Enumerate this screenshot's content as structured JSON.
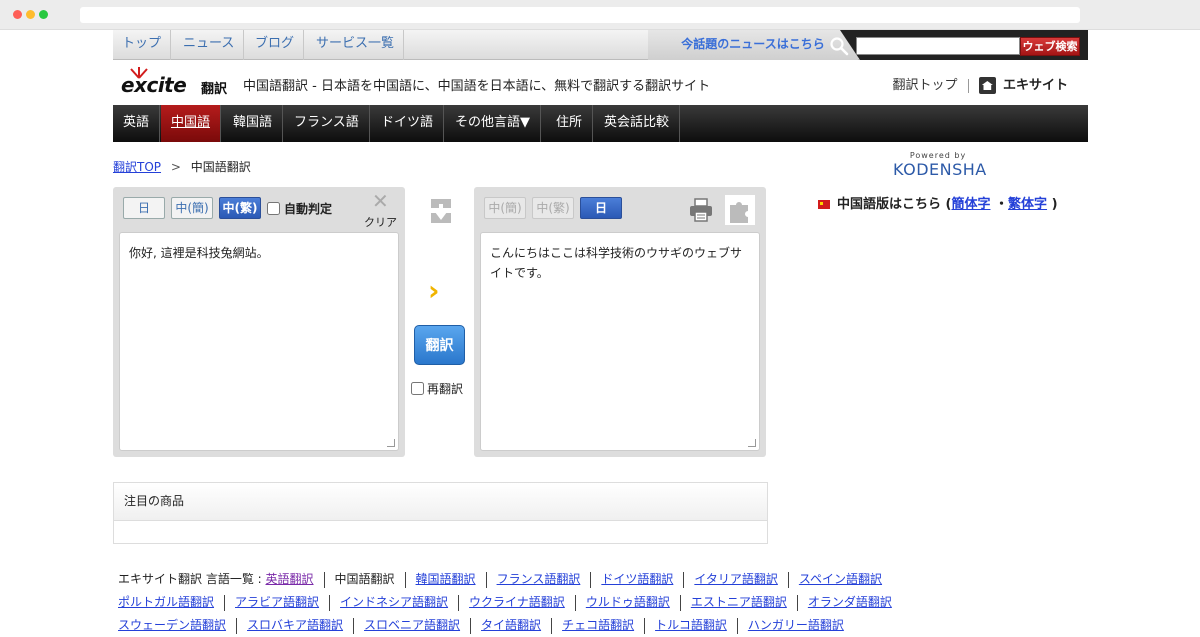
{
  "topnav": {
    "items": [
      "トップ",
      "ニュース",
      "ブログ",
      "サービス一覧"
    ],
    "hot_news": "今話題のニュースはこちら",
    "search_placeholder": "",
    "search_button": "ウェブ検索"
  },
  "header": {
    "logo_text": "excite",
    "logo_sub": "翻訳",
    "tagline": "中国語翻訳 - 日本語を中国語に、中国語を日本語に、無料で翻訳する翻訳サイト",
    "top_link": "翻訳トップ",
    "site_link": "エキサイト"
  },
  "langnav": {
    "items": [
      "英語",
      "中国語",
      "韓国語",
      "フランス語",
      "ドイツ語",
      "その他言語▼",
      "住所",
      "英会話比較"
    ],
    "active": "中国語"
  },
  "breadcrumb": {
    "home": "翻訳TOP",
    "sep": ">",
    "current": "中国語翻訳"
  },
  "powered": {
    "by": "Powered by",
    "brand": "KODENSHA"
  },
  "cn_version": {
    "label": "中国語版はこちら (",
    "simplified": "簡体字",
    "dot": "・",
    "traditional": "繁体字",
    "close": ")"
  },
  "source": {
    "lang_ja": "日",
    "lang_zh_simplified": "中(簡)",
    "lang_zh_traditional": "中(繁)",
    "auto_detect": "自動判定",
    "clear": "クリア",
    "text": "你好, 這裡是科技兔網站。"
  },
  "target": {
    "lang_zh_simplified": "中(簡)",
    "lang_zh_traditional": "中(繁)",
    "lang_ja": "日",
    "text": "こんにちはここは科学技術のウサギのウェブサイトです。"
  },
  "controls": {
    "translate": "翻訳",
    "retranslate": "再翻訳"
  },
  "featured": {
    "title": "注目の商品"
  },
  "langlist": {
    "prefix": "エキサイト翻訳 言語一覧 :",
    "row1": [
      "英語翻訳",
      "中国語翻訳",
      "韓国語翻訳",
      "フランス語翻訳",
      "ドイツ語翻訳",
      "イタリア語翻訳",
      "スペイン語翻訳"
    ],
    "row2": [
      "ポルトガル語翻訳",
      "アラビア語翻訳",
      "インドネシア語翻訳",
      "ウクライナ語翻訳",
      "ウルドゥ語翻訳",
      "エストニア語翻訳",
      "オランダ語翻訳"
    ],
    "row3": [
      "スウェーデン語翻訳",
      "スロバキア語翻訳",
      "スロベニア語翻訳",
      "タイ語翻訳",
      "チェコ語翻訳",
      "トルコ語翻訳",
      "ハンガリー語翻訳"
    ]
  },
  "colors": {
    "accent_red": "#b51c1c",
    "link_blue": "#2440d8",
    "selected_blue": "#2b59b5"
  }
}
